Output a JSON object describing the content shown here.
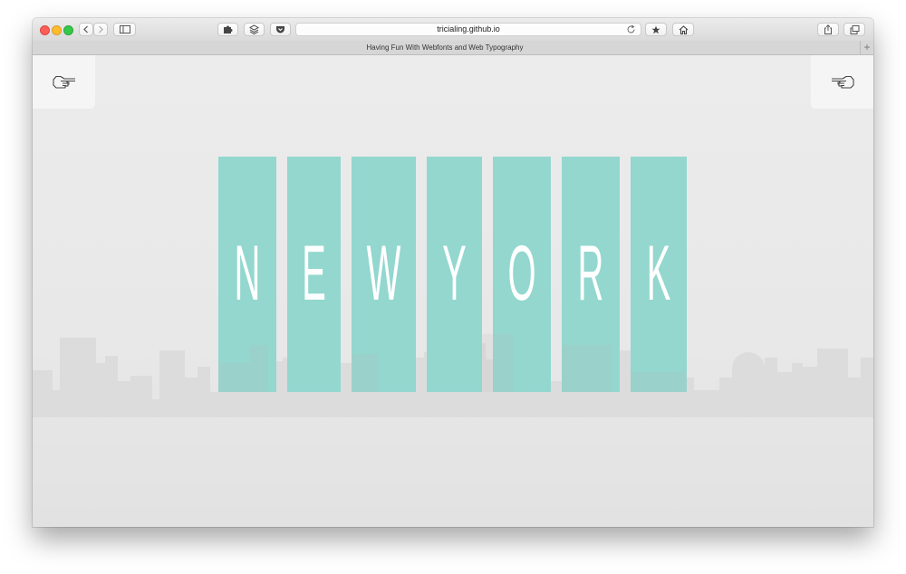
{
  "browser": {
    "url": "tricialing.github.io",
    "tab_title": "Having Fun With Webfonts and Web Typography",
    "new_tab_label": "+"
  },
  "page": {
    "letters": [
      "N",
      "E",
      "W",
      "Y",
      "O",
      "R",
      "K"
    ],
    "colors": {
      "panel": "#93d7cf",
      "letter": "#ffffff",
      "background": "#e9e9e9",
      "skyline": "#dcdcdc"
    },
    "prev_icon": "pointing-hand-left-icon",
    "next_icon": "pointing-hand-right-icon"
  }
}
